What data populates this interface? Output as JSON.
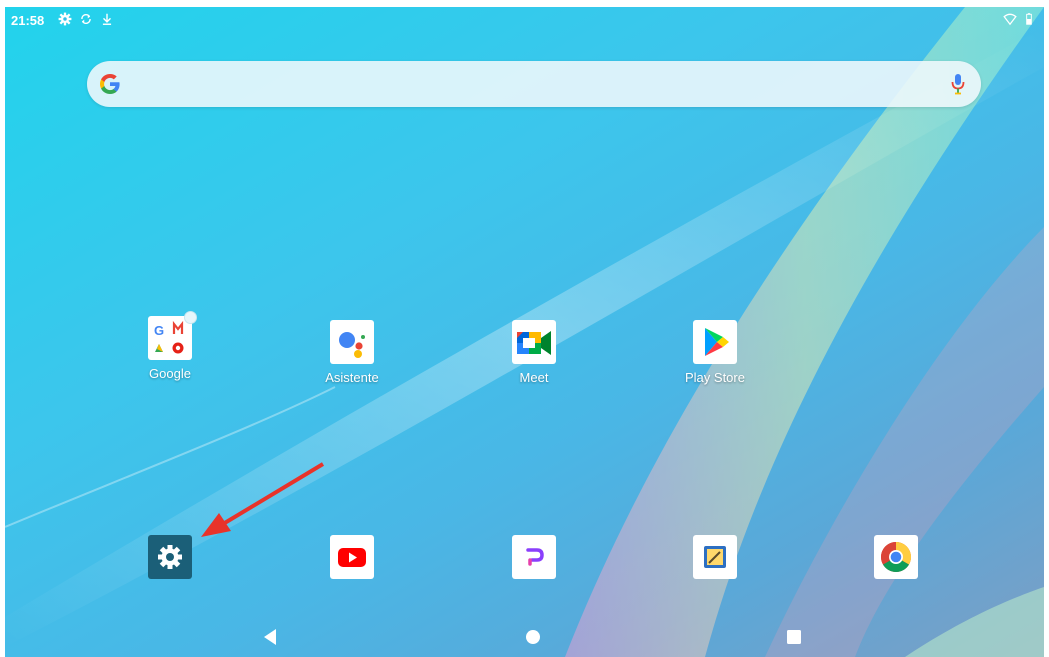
{
  "status_bar": {
    "time": "21:58",
    "icons": [
      "gear-icon",
      "sync-icon",
      "download-icon",
      "wifi-icon",
      "battery-icon"
    ]
  },
  "search_bar": {
    "logo": "google-g-icon",
    "mic": "microphone-icon",
    "value": "",
    "placeholder": ""
  },
  "apps_row": [
    {
      "label": "Google",
      "icon": "google-folder-icon"
    },
    {
      "label": "Asistente",
      "icon": "assistant-icon"
    },
    {
      "label": "Meet",
      "icon": "meet-icon"
    },
    {
      "label": "Play Store",
      "icon": "play-store-icon"
    }
  ],
  "dock": [
    {
      "icon": "settings-icon"
    },
    {
      "icon": "youtube-icon"
    },
    {
      "icon": "picsart-icon"
    },
    {
      "icon": "notes-icon"
    },
    {
      "icon": "chrome-icon"
    }
  ],
  "nav_bar": {
    "back": "back-icon",
    "home": "home-icon",
    "recents": "recents-icon"
  },
  "annotation": {
    "type": "red-arrow",
    "points_to": "settings-icon",
    "color": "#e8332a"
  },
  "colors": {
    "accent_red": "#e8332a",
    "settings_tile": "#1b5f78"
  }
}
